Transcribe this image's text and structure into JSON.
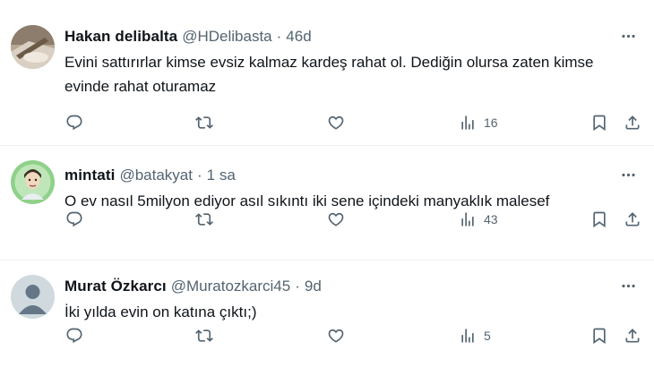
{
  "tweets": [
    {
      "name": "Hakan delibalta",
      "handle": "@HDelibasta",
      "separator": "·",
      "time": "46d",
      "text": "Evini sattırırlar kimse evsiz kalmaz kardeş rahat ol. Dediğin olursa zaten kimse evinde rahat oturamaz",
      "views": "16",
      "avatar": "photo-avatar"
    },
    {
      "name": "mintati",
      "handle": "@batakyat",
      "separator": "·",
      "time": "1 sa",
      "text": "O ev nasıl 5milyon ediyor asıl sıkıntı iki sene içindeki manyaklık malesef",
      "views": "43",
      "avatar": "cartoon-avatar"
    },
    {
      "name": "Murat Özkarcı",
      "handle": "@Muratozkarci45",
      "separator": "·",
      "time": "9d",
      "text": "İki yılda evin on katına çıktı;)",
      "views": "5",
      "avatar": "default-avatar"
    }
  ],
  "icons": {
    "more": "more-horizontal-icon",
    "reply": "reply-icon",
    "retweet": "retweet-icon",
    "like": "heart-icon",
    "views": "views-bar-chart-icon",
    "bookmark": "bookmark-icon",
    "share": "share-icon"
  },
  "colors": {
    "text": "#0f1419",
    "secondary": "#536471",
    "divider": "#eff3f4"
  }
}
